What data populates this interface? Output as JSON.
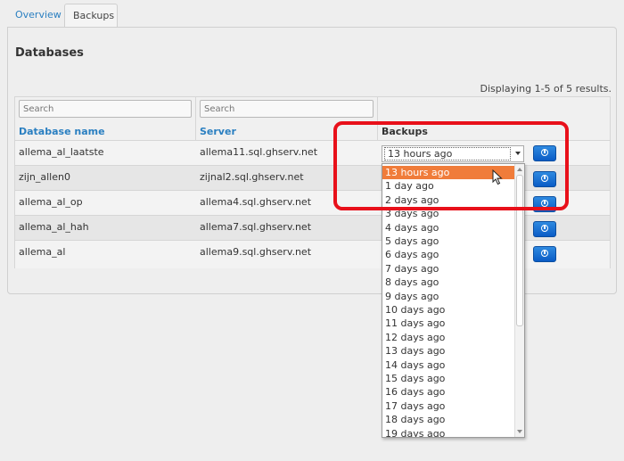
{
  "tabs": [
    {
      "label": "Overview",
      "active": false
    },
    {
      "label": "Backups",
      "active": true
    }
  ],
  "page_title": "Databases",
  "summary": "Displaying 1-5 of 5 results.",
  "filters": {
    "name_placeholder": "Search",
    "server_placeholder": "Search"
  },
  "columns": {
    "name": "Database name",
    "server": "Server",
    "backups": "Backups"
  },
  "rows": [
    {
      "name": "allema_al_laatste",
      "server": "allema11.sql.ghserv.net"
    },
    {
      "name": "zijn_allen0",
      "server": "zijnal2.sql.ghserv.net"
    },
    {
      "name": "allema_al_op",
      "server": "allema4.sql.ghserv.net"
    },
    {
      "name": "allema_al_hah",
      "server": "allema7.sql.ghserv.net"
    },
    {
      "name": "allema_al",
      "server": "allema9.sql.ghserv.net"
    }
  ],
  "backup_select": {
    "value": "13 hours ago",
    "options": [
      "13 hours ago",
      "1 day ago",
      "2 days ago",
      "3 days ago",
      "4 days ago",
      "5 days ago",
      "6 days ago",
      "7 days ago",
      "8 days ago",
      "9 days ago",
      "10 days ago",
      "11 days ago",
      "12 days ago",
      "13 days ago",
      "14 days ago",
      "15 days ago",
      "16 days ago",
      "17 days ago",
      "18 days ago",
      "19 days ago"
    ],
    "selected_index": 0
  },
  "colors": {
    "link": "#2a7fc1",
    "highlight": "#e8101a",
    "option_selected": "#f07c3a",
    "button": "#0a5cc6"
  },
  "icons": {
    "restore_button": "power-icon",
    "cursor": "mouse-pointer-icon"
  }
}
